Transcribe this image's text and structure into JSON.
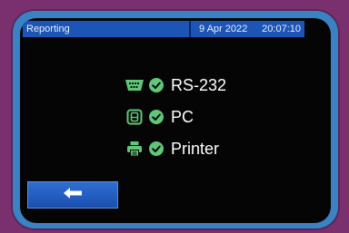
{
  "statusbar": {
    "title": "Reporting",
    "date": "9 Apr 2022",
    "time": "20:07:10"
  },
  "items": [
    {
      "label": "RS-232",
      "icon": "serial-port-icon",
      "status": "check-icon"
    },
    {
      "label": "PC",
      "icon": "pc-icon",
      "status": "check-icon"
    },
    {
      "label": "Printer",
      "icon": "printer-icon",
      "status": "check-icon"
    }
  ],
  "navigation": {
    "back_icon": "arrow-left-icon"
  },
  "colors": {
    "background": "#7a2f6f",
    "bezel": "#3b82c4",
    "status_bar": "#1c55b5",
    "icon_green": "#5ec77a",
    "button_blue": "#1f5cc4"
  }
}
